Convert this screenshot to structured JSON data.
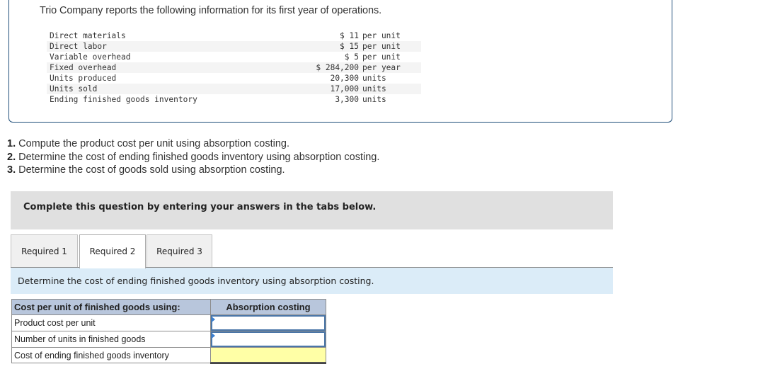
{
  "problem": {
    "intro": "Trio Company reports the following information for its first year of operations.",
    "data_rows": [
      {
        "label": "Direct materials",
        "value": "$ 11",
        "unit": "per unit"
      },
      {
        "label": "Direct labor",
        "value": "$ 15",
        "unit": "per unit"
      },
      {
        "label": "Variable overhead",
        "value": "$ 5",
        "unit": "per unit"
      },
      {
        "label": "Fixed overhead",
        "value": "$ 284,200",
        "unit": "per year"
      },
      {
        "label": "Units produced",
        "value": "20,300",
        "unit": "units"
      },
      {
        "label": "Units sold",
        "value": "17,000",
        "unit": "units"
      },
      {
        "label": "Ending finished goods inventory",
        "value": "3,300",
        "unit": "units"
      }
    ]
  },
  "questions": [
    {
      "number": "1.",
      "text": " Compute the product cost per unit using absorption costing."
    },
    {
      "number": "2.",
      "text": " Determine the cost of ending finished goods inventory using absorption costing."
    },
    {
      "number": "3.",
      "text": " Determine the cost of goods sold using absorption costing."
    }
  ],
  "banner": "Complete this question by entering your answers in the tabs below.",
  "tabs": [
    {
      "label": "Required 1",
      "active": false
    },
    {
      "label": "Required 2",
      "active": true
    },
    {
      "label": "Required 3",
      "active": false
    }
  ],
  "instruction": "Determine the cost of ending finished goods inventory using absorption costing.",
  "answer_table": {
    "header_label": "Cost per unit of finished goods using:",
    "header_column": "Absorption costing",
    "rows": [
      {
        "label": "Product cost per unit",
        "value": "",
        "type": "input"
      },
      {
        "label": "Number of units in finished goods",
        "value": "",
        "type": "input"
      },
      {
        "label": "Cost of ending finished goods inventory",
        "value": "",
        "type": "total"
      }
    ]
  },
  "colors": {
    "info_border": "#1f4e79",
    "banner_bg": "#e0e0e0",
    "instruction_bg": "#dbecf8",
    "table_header_bg": "#b8c6dc",
    "input_border": "#4a76a8",
    "total_bg": "#ffffa6"
  }
}
